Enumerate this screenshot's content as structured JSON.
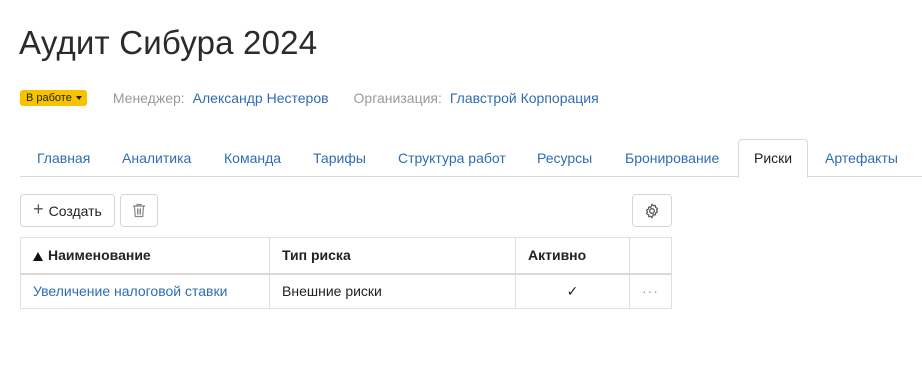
{
  "page": {
    "title": "Аудит Сибура 2024"
  },
  "meta": {
    "status": "В работе",
    "manager_label": "Менеджер:",
    "manager_name": "Александр Нестеров",
    "org_label": "Организация:",
    "org_name": "Главстрой Корпорация"
  },
  "tabs": [
    {
      "label": "Главная",
      "active": false
    },
    {
      "label": "Аналитика",
      "active": false
    },
    {
      "label": "Команда",
      "active": false
    },
    {
      "label": "Тарифы",
      "active": false
    },
    {
      "label": "Структура работ",
      "active": false
    },
    {
      "label": "Ресурсы",
      "active": false
    },
    {
      "label": "Бронирование",
      "active": false
    },
    {
      "label": "Риски",
      "active": true
    },
    {
      "label": "Артефакты",
      "active": false
    }
  ],
  "toolbar": {
    "create_label": "Создать",
    "delete_icon": "trash-icon",
    "settings_icon": "gear-icon"
  },
  "table": {
    "columns": {
      "name": "Наименование",
      "type": "Тип риска",
      "active": "Активно"
    },
    "sort": {
      "column": "name",
      "direction": "asc"
    },
    "rows": [
      {
        "name": "Увеличение налоговой ставки",
        "type": "Внешние риски",
        "active": "✓",
        "menu": "···"
      }
    ]
  },
  "colors": {
    "status_badge": "#f7c300",
    "link": "#2f6db3",
    "muted_label": "#9a9a9a"
  }
}
